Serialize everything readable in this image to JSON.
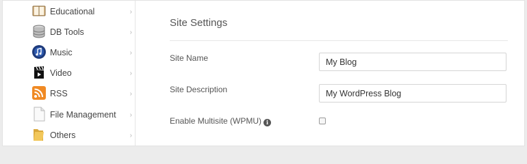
{
  "sidebar": {
    "items": [
      {
        "label": "Educational",
        "icon": "book-icon"
      },
      {
        "label": "DB Tools",
        "icon": "database-icon"
      },
      {
        "label": "Music",
        "icon": "music-icon"
      },
      {
        "label": "Video",
        "icon": "video-clapper-icon"
      },
      {
        "label": "RSS",
        "icon": "rss-icon"
      },
      {
        "label": "File Management",
        "icon": "file-icon"
      },
      {
        "label": "Others",
        "icon": "folder-icon"
      }
    ],
    "chevron": "›"
  },
  "main": {
    "title": "Site Settings",
    "site_name": {
      "label": "Site Name",
      "value": "My Blog"
    },
    "site_description": {
      "label": "Site Description",
      "value": "My WordPress Blog"
    },
    "multisite": {
      "label": "Enable Multisite (WPMU)",
      "checked": false
    }
  },
  "colors": {
    "rss": "#f08a24",
    "music": "#1e3a7a",
    "folder": "#e8b84a"
  }
}
